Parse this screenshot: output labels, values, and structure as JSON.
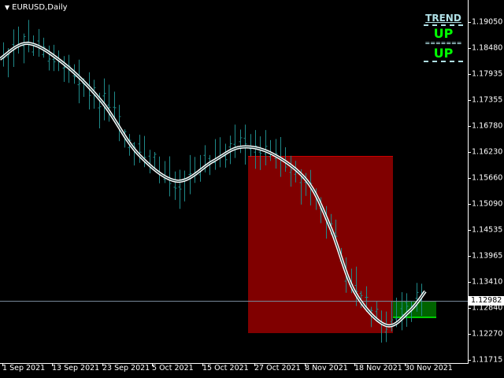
{
  "header": {
    "symbol_timeframe": "EURUSD,Daily"
  },
  "indicator": {
    "title": "TREND",
    "signal1": "UP",
    "signal2": "UP",
    "separator": "=======",
    "title_color": "#b0e0e6",
    "signal_color": "#00ff00"
  },
  "price_axis": [
    "1.19050",
    "1.18480",
    "1.17935",
    "1.17355",
    "1.16780",
    "1.16230",
    "1.15660",
    "1.15090",
    "1.14535",
    "1.13965",
    "1.13410",
    "1.12840",
    "1.12270",
    "1.11715"
  ],
  "current_price": "1.12982",
  "time_axis": [
    "1 Sep 2021",
    "13 Sep 2021",
    "23 Sep 2021",
    "5 Oct 2021",
    "15 Oct 2021",
    "27 Oct 2021",
    "8 Nov 2021",
    "18 Nov 2021",
    "30 Nov 2021"
  ],
  "colors": {
    "bars": "#1f8a8a",
    "sell_zone": "#800000",
    "buy_zone": "#006400",
    "line": "#ffffff",
    "bid_line": "#778899"
  },
  "chart_data": {
    "type": "ohlc",
    "title": "EURUSD,Daily",
    "ylim": [
      1.116,
      1.196
    ],
    "last": 1.12982
  }
}
